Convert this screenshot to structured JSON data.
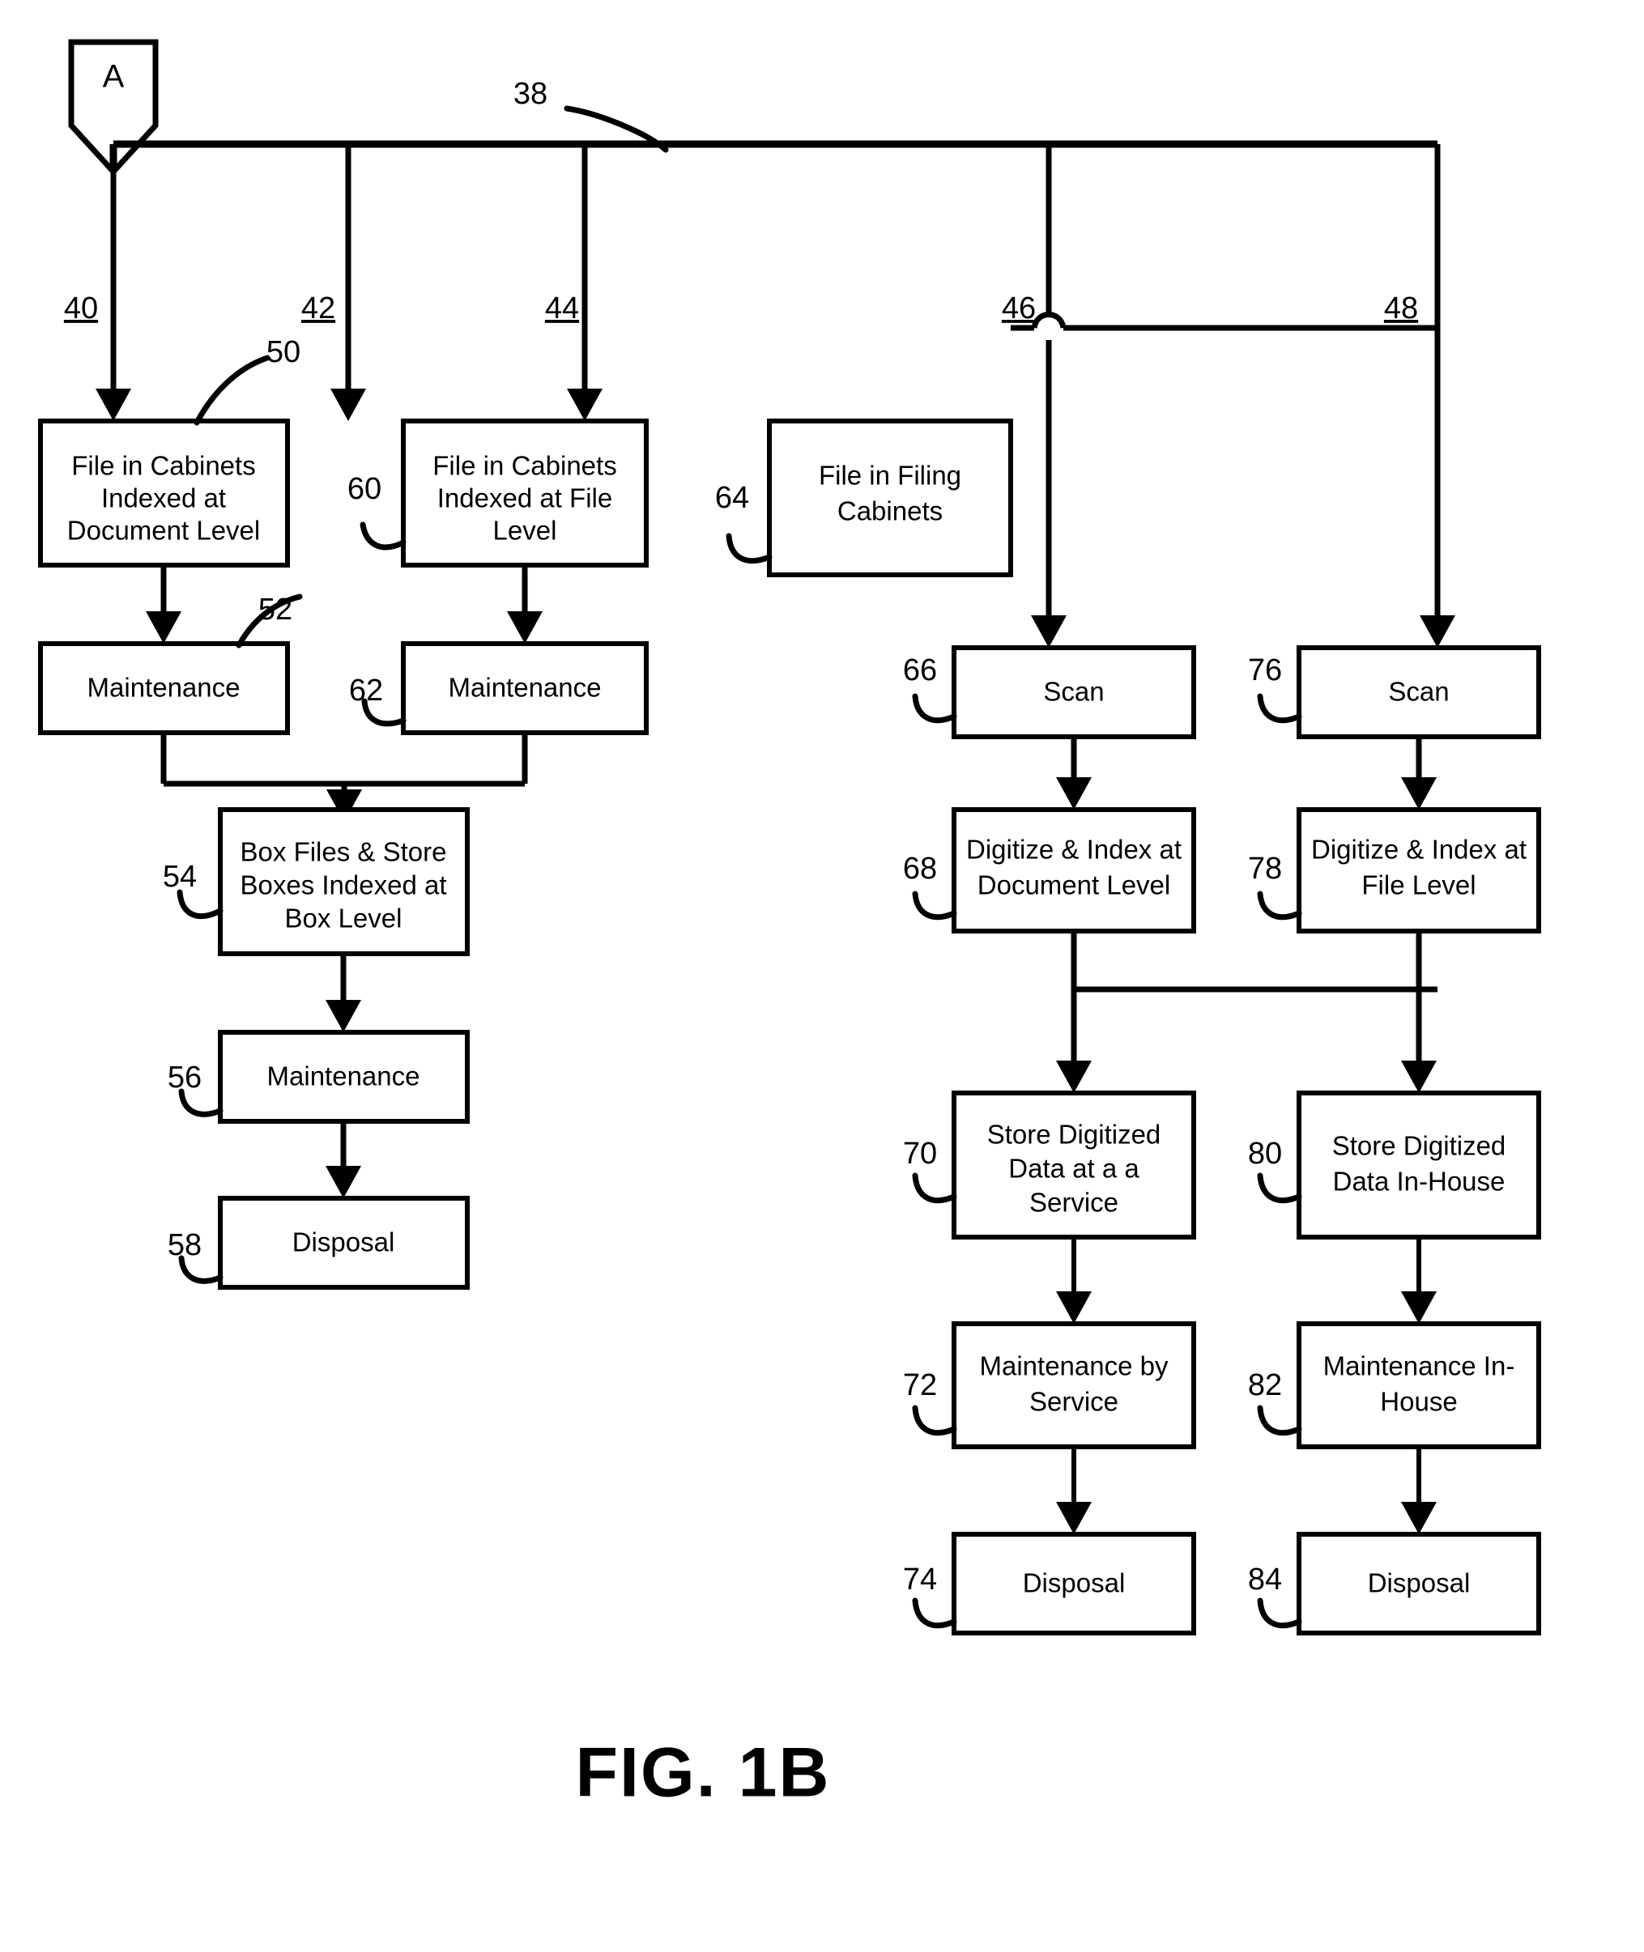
{
  "figure": {
    "caption": "FIG. 1B",
    "type": "patent-flowchart"
  },
  "connector": {
    "label": "A",
    "name": "off-page-connector-a"
  },
  "bus": {
    "ref": "38"
  },
  "branches": [
    {
      "ref": "40"
    },
    {
      "ref": "42"
    },
    {
      "ref": "44"
    },
    {
      "ref": "46"
    },
    {
      "ref": "48"
    }
  ],
  "nodes": [
    {
      "ref": "50",
      "text": "File in Cabinets Indexed at Document Level",
      "lines": [
        "File in Cabinets",
        "Indexed at",
        "Document Level"
      ]
    },
    {
      "ref": "52",
      "text": "Maintenance",
      "lines": [
        "Maintenance"
      ]
    },
    {
      "ref": "54",
      "text": "Box Files & Store Boxes Indexed at Box Level",
      "lines": [
        "Box Files & Store",
        "Boxes Indexed at",
        "Box Level"
      ]
    },
    {
      "ref": "56",
      "text": "Maintenance",
      "lines": [
        "Maintenance"
      ]
    },
    {
      "ref": "58",
      "text": "Disposal",
      "lines": [
        "Disposal"
      ]
    },
    {
      "ref": "60",
      "text": "File in Cabinets Indexed at File Level",
      "lines": [
        "File in Cabinets",
        "Indexed at File",
        "Level"
      ]
    },
    {
      "ref": "62",
      "text": "Maintenance",
      "lines": [
        "Maintenance"
      ]
    },
    {
      "ref": "64",
      "text": "File in Filing Cabinets",
      "lines": [
        "File in Filing",
        "Cabinets"
      ]
    },
    {
      "ref": "66",
      "text": "Scan",
      "lines": [
        "Scan"
      ]
    },
    {
      "ref": "68",
      "text": "Digitize & Index at Document Level",
      "lines": [
        "Digitize & Index at",
        "Document Level"
      ]
    },
    {
      "ref": "70",
      "text": "Store Digitized Data at a a Service",
      "lines": [
        "Store Digitized",
        "Data at a a",
        "Service"
      ]
    },
    {
      "ref": "72",
      "text": "Maintenance by Service",
      "lines": [
        "Maintenance by",
        "Service"
      ]
    },
    {
      "ref": "74",
      "text": "Disposal",
      "lines": [
        "Disposal"
      ]
    },
    {
      "ref": "76",
      "text": "Scan",
      "lines": [
        "Scan"
      ]
    },
    {
      "ref": "78",
      "text": "Digitize & Index at File Level",
      "lines": [
        "Digitize & Index at",
        "File Level"
      ]
    },
    {
      "ref": "80",
      "text": "Store Digitized Data In-House",
      "lines": [
        "Store Digitized",
        "Data In-House"
      ]
    },
    {
      "ref": "82",
      "text": "Maintenance In-House",
      "lines": [
        "Maintenance In-",
        "House"
      ]
    },
    {
      "ref": "84",
      "text": "Disposal",
      "lines": [
        "Disposal"
      ]
    }
  ],
  "colors": {
    "stroke": "#000000",
    "fill": "#ffffff",
    "background": "#ffffff"
  }
}
